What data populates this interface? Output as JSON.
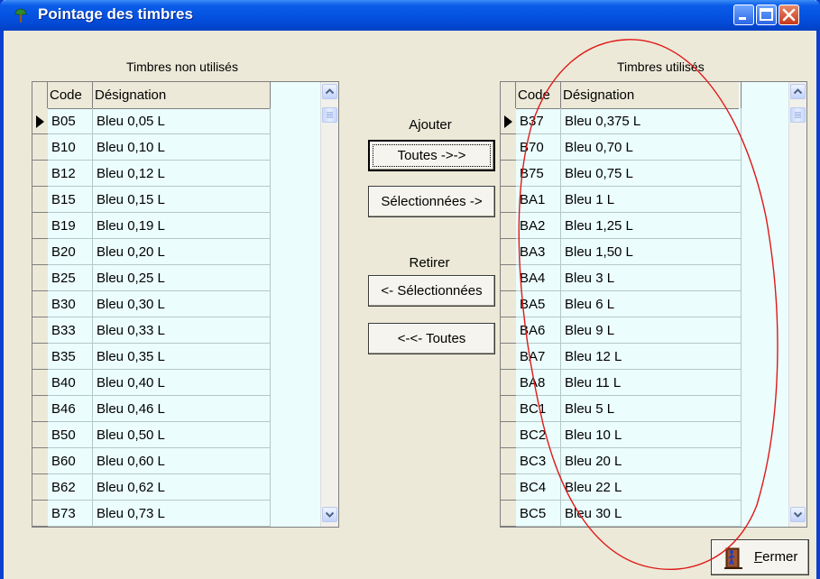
{
  "window": {
    "title": "Pointage des timbres"
  },
  "left_panel": {
    "label": "Timbres non utilisés",
    "columns": [
      "Code",
      "Désignation"
    ],
    "rows": [
      {
        "code": "B05",
        "designation": "Bleu 0,05 L"
      },
      {
        "code": "B10",
        "designation": "Bleu 0,10 L"
      },
      {
        "code": "B12",
        "designation": "Bleu 0,12 L"
      },
      {
        "code": "B15",
        "designation": "Bleu 0,15 L"
      },
      {
        "code": "B19",
        "designation": "Bleu 0,19 L"
      },
      {
        "code": "B20",
        "designation": "Bleu 0,20 L"
      },
      {
        "code": "B25",
        "designation": "Bleu 0,25 L"
      },
      {
        "code": "B30",
        "designation": "Bleu 0,30 L"
      },
      {
        "code": "B33",
        "designation": "Bleu 0,33 L"
      },
      {
        "code": "B35",
        "designation": "Bleu 0,35 L"
      },
      {
        "code": "B40",
        "designation": "Bleu 0,40 L"
      },
      {
        "code": "B46",
        "designation": "Bleu 0,46 L"
      },
      {
        "code": "B50",
        "designation": "Bleu 0,50 L"
      },
      {
        "code": "B60",
        "designation": "Bleu 0,60 L"
      },
      {
        "code": "B62",
        "designation": "Bleu 0,62 L"
      },
      {
        "code": "B73",
        "designation": "Bleu 0,73 L"
      }
    ]
  },
  "right_panel": {
    "label": "Timbres utilisés",
    "columns": [
      "Code",
      "Désignation"
    ],
    "rows": [
      {
        "code": "B37",
        "designation": "Bleu 0,375 L"
      },
      {
        "code": "B70",
        "designation": "Bleu 0,70 L"
      },
      {
        "code": "B75",
        "designation": "Bleu 0,75 L"
      },
      {
        "code": "BA1",
        "designation": "Bleu 1 L"
      },
      {
        "code": "BA2",
        "designation": "Bleu 1,25 L"
      },
      {
        "code": "BA3",
        "designation": "Bleu 1,50 L"
      },
      {
        "code": "BA4",
        "designation": "Bleu 3 L"
      },
      {
        "code": "BA5",
        "designation": "Bleu 6 L"
      },
      {
        "code": "BA6",
        "designation": "Bleu 9 L"
      },
      {
        "code": "BA7",
        "designation": "Bleu 12 L"
      },
      {
        "code": "BA8",
        "designation": "Bleu 11 L"
      },
      {
        "code": "BC1",
        "designation": "Bleu 5 L"
      },
      {
        "code": "BC2",
        "designation": "Bleu  10 L"
      },
      {
        "code": "BC3",
        "designation": "Bleu 20 L"
      },
      {
        "code": "BC4",
        "designation": "Bleu 22 L"
      },
      {
        "code": "BC5",
        "designation": "Bleu 30 L"
      }
    ]
  },
  "actions": {
    "add_label": "Ajouter",
    "add_all": "Toutes ->->",
    "add_selected": "Sélectionnées ->",
    "remove_label": "Retirer",
    "remove_selected": "<- Sélectionnées",
    "remove_all": "<-<- Toutes"
  },
  "close_button": {
    "mnemonic": "F",
    "rest": "ermer"
  },
  "colors": {
    "title_bar": "#0451e0",
    "grid_background": "#ecfdfd",
    "window_background": "#ece9d8",
    "annotation_ellipse": "#e01818"
  }
}
